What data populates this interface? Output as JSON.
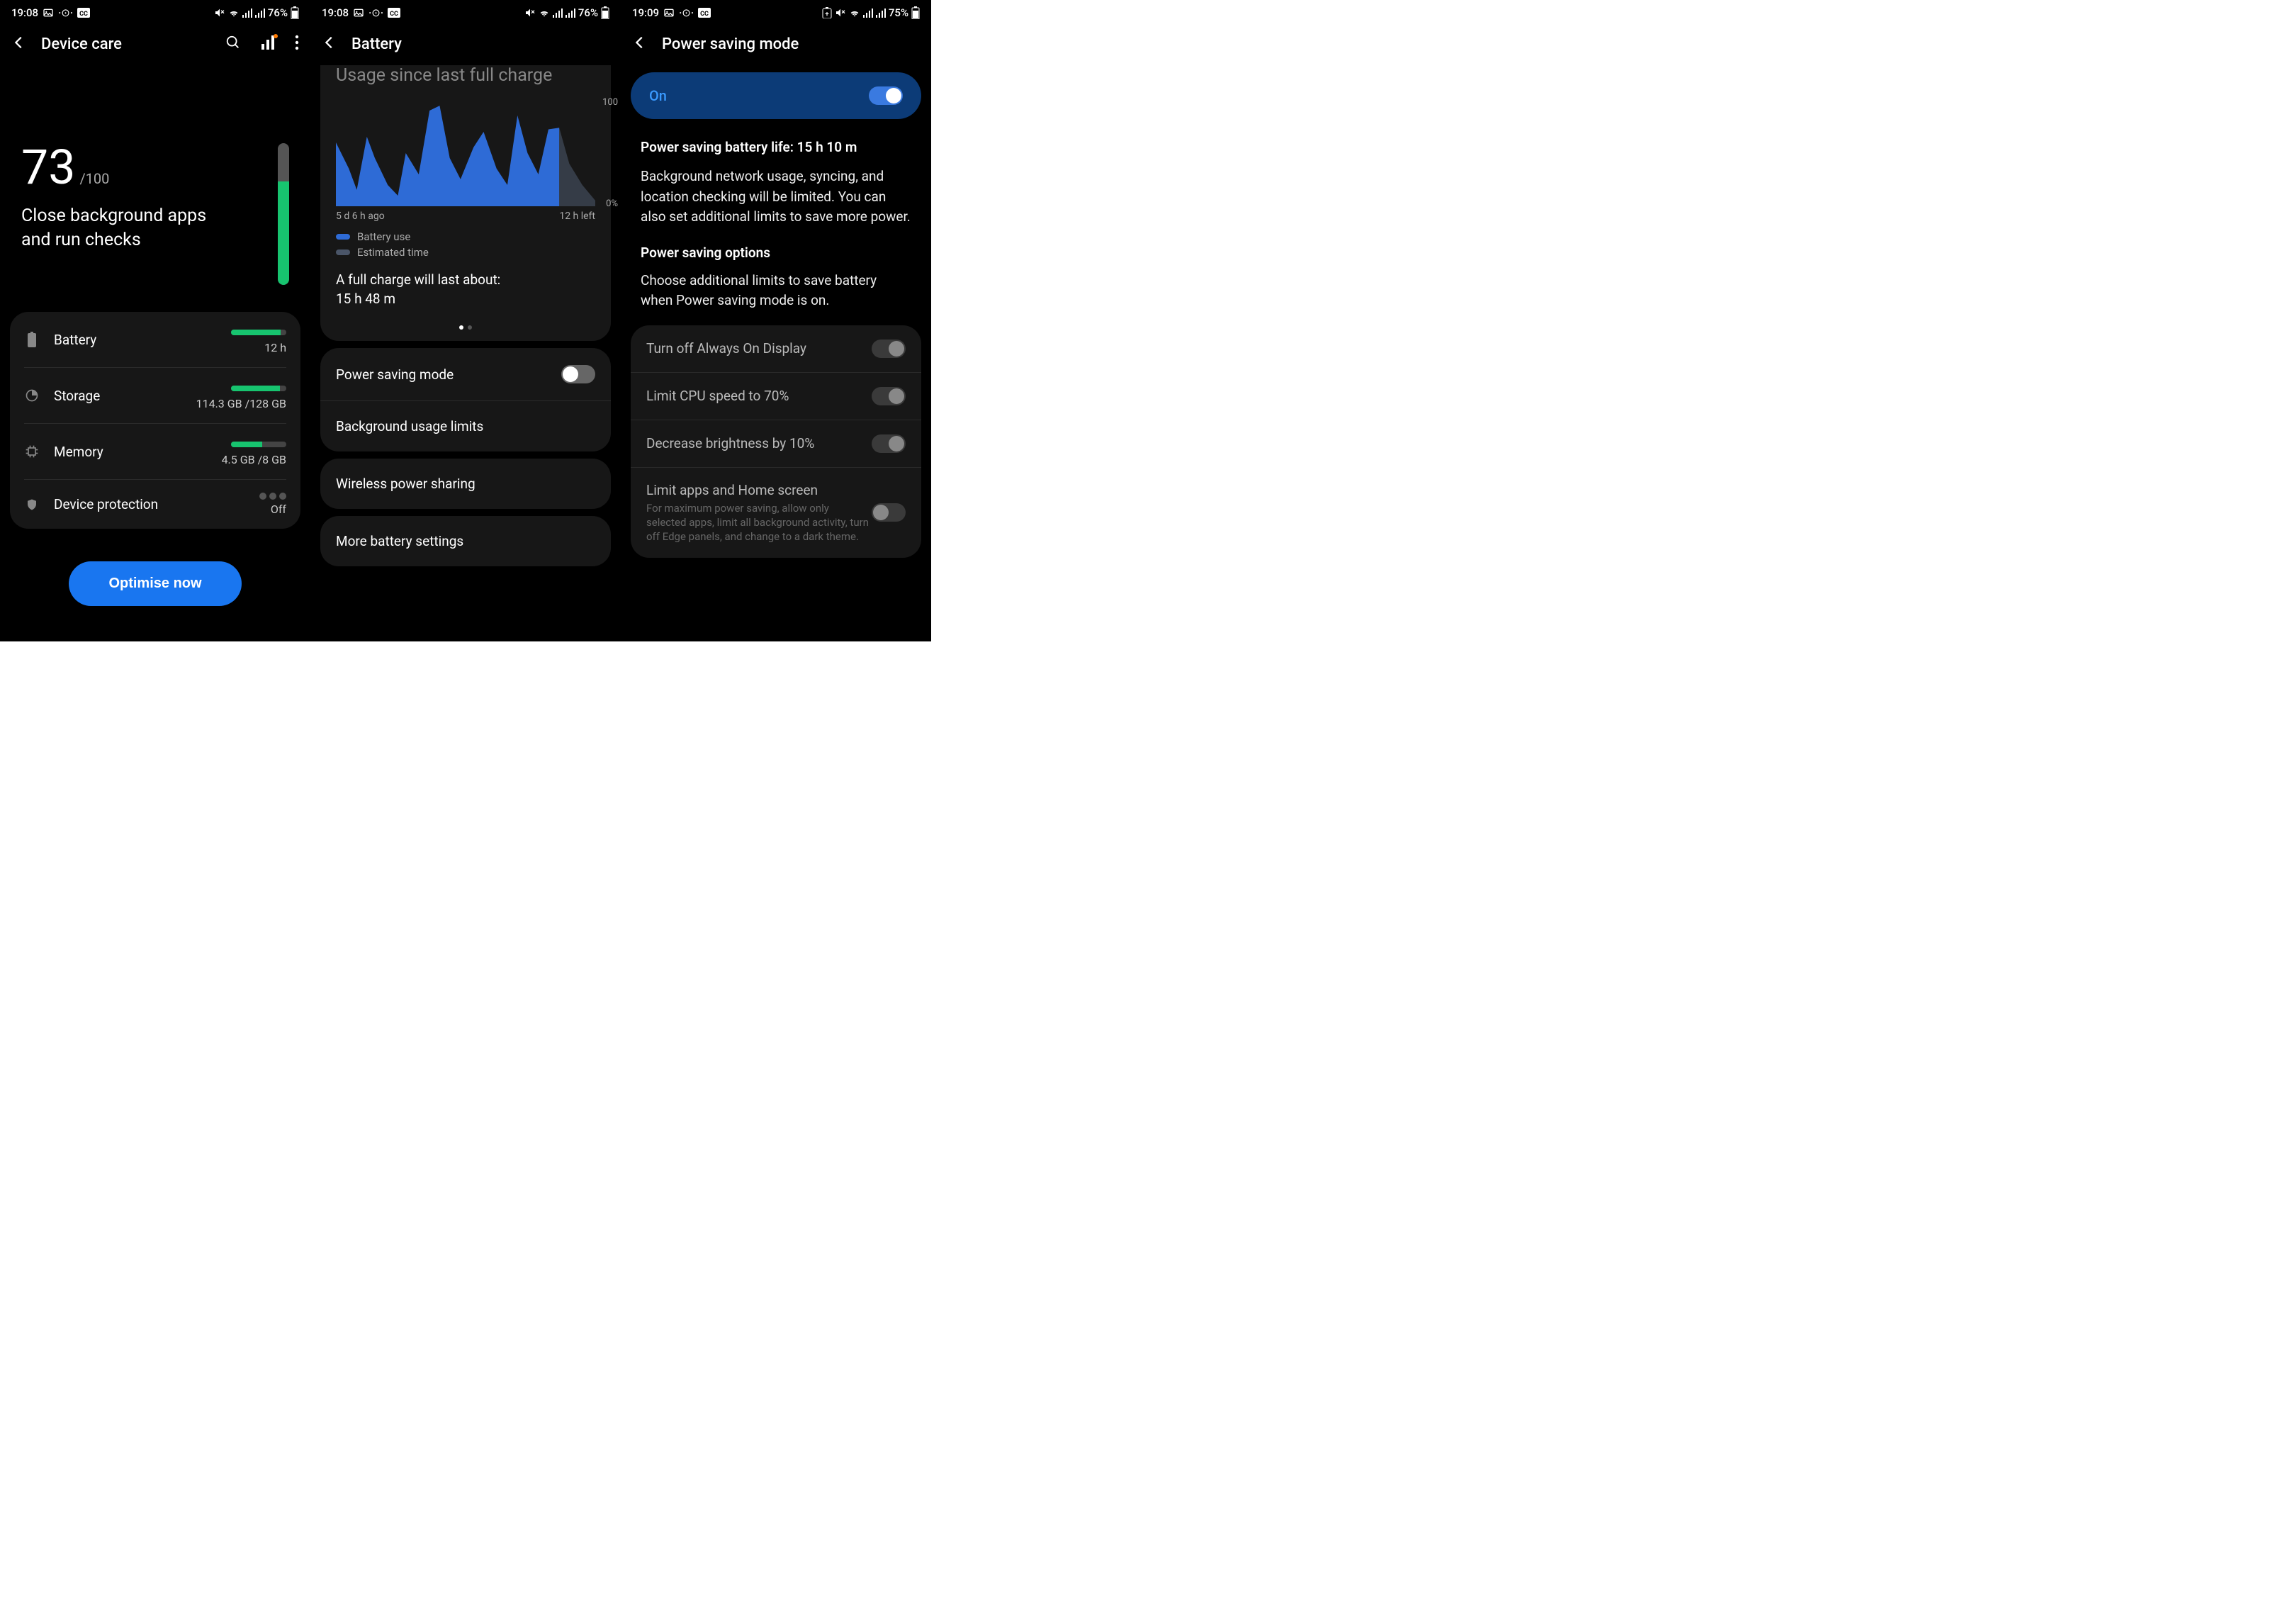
{
  "screen1": {
    "status_time": "19:08",
    "status_battery": "76%",
    "title": "Device care",
    "score": "73",
    "score_suffix": "/100",
    "score_pct": 73,
    "score_desc": "Close background apps and run checks",
    "rows": {
      "battery": {
        "label": "Battery",
        "value": "12 h",
        "pct": 90
      },
      "storage": {
        "label": "Storage",
        "value": "114.3 GB /128 GB",
        "pct": 89
      },
      "memory": {
        "label": "Memory",
        "value": "4.5 GB /8 GB",
        "pct": 56
      },
      "protection": {
        "label": "Device protection",
        "value": "Off"
      }
    },
    "optimise": "Optimise now"
  },
  "screen2": {
    "status_time": "19:08",
    "status_battery": "76%",
    "title": "Battery",
    "usage_title": "Usage since last full charge",
    "x_start": "5 d 6 h ago",
    "x_end": "12 h left",
    "y_top": "100",
    "y_bot": "0%",
    "legend1": "Battery use",
    "legend2": "Estimated time",
    "full_charge_label": "A full charge will last about:",
    "full_charge_value": "15 h 48 m",
    "rows": {
      "psm": "Power saving mode",
      "bg": "Background usage limits",
      "wps": "Wireless power sharing",
      "more": "More battery settings"
    }
  },
  "screen3": {
    "status_time": "19:09",
    "status_battery": "75%",
    "title": "Power saving mode",
    "on_label": "On",
    "life_label": "Power saving battery life: 15 h 10 m",
    "desc": "Background network usage, syncing, and location checking will be limited. You can also set additional limits to save more power.",
    "options_title": "Power saving options",
    "options_desc": "Choose additional limits to save battery when Power saving mode is on.",
    "opts": {
      "aod": "Turn off Always On Display",
      "cpu": "Limit CPU speed to 70%",
      "bright": "Decrease brightness by 10%",
      "limit_apps": "Limit apps and Home screen",
      "limit_apps_sub": "For maximum power saving, allow only selected apps, limit all background activity, turn off Edge panels, and change to a dark theme."
    }
  },
  "chart_data": {
    "type": "area",
    "title": "Usage since last full charge",
    "xlabel": "",
    "ylabel": "%",
    "ylim": [
      0,
      100
    ],
    "x_range_label": [
      "5 d 6 h ago",
      "12 h left"
    ],
    "series": [
      {
        "name": "Battery use",
        "x": [
          0,
          5,
          8,
          12,
          15,
          20,
          24,
          27,
          32,
          36,
          40,
          44,
          48,
          53,
          57,
          62,
          66,
          70,
          74,
          78,
          82,
          86,
          90,
          95,
          100
        ],
        "values": [
          60,
          35,
          15,
          65,
          45,
          20,
          10,
          50,
          30,
          90,
          95,
          45,
          25,
          55,
          70,
          35,
          20,
          85,
          50,
          30,
          72,
          74,
          40,
          20,
          5
        ]
      },
      {
        "name": "Estimated time",
        "x": [
          86,
          100
        ],
        "values": [
          74,
          0
        ]
      }
    ]
  }
}
